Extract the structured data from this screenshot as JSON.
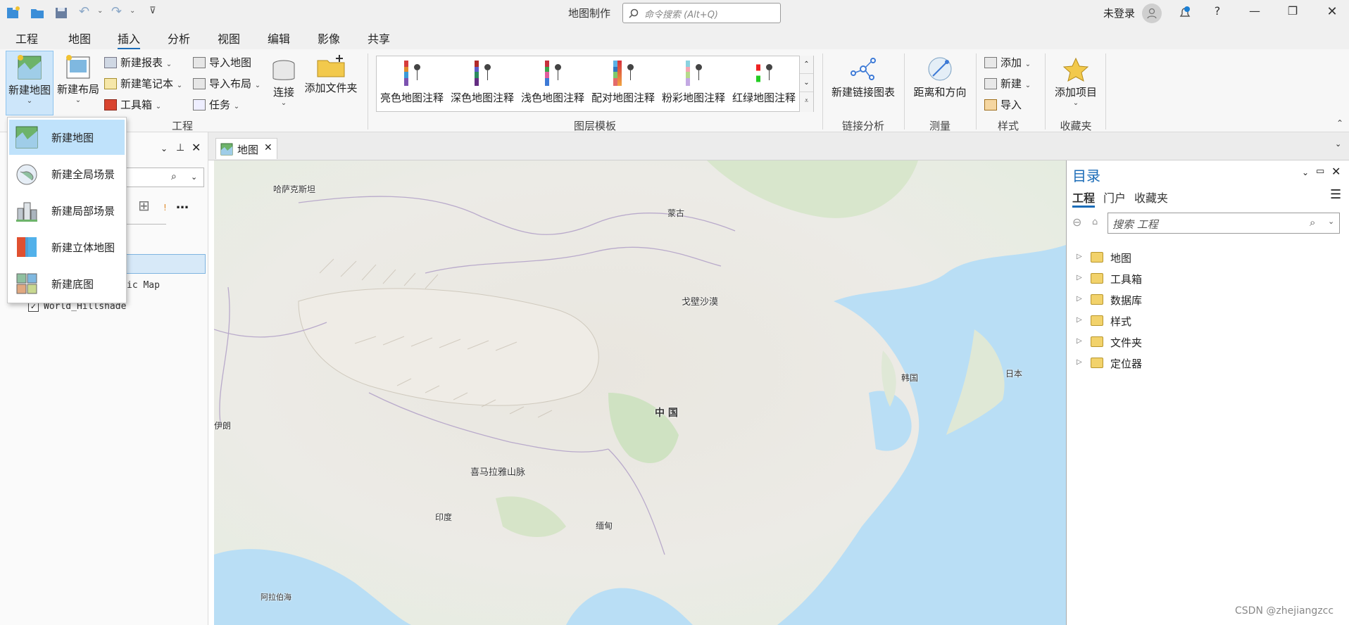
{
  "app": {
    "title": "地图制作",
    "command_search_placeholder": "命令搜索 (Alt+Q)",
    "login": "未登录"
  },
  "menu_tabs": [
    "工程",
    "地图",
    "插入",
    "分析",
    "视图",
    "编辑",
    "影像",
    "共享"
  ],
  "active_tab": "插入",
  "ribbon": {
    "project_group": {
      "label": "工程",
      "new_map": "新建地图",
      "new_layout": "新建布局",
      "new_report": "新建报表",
      "new_notebook": "新建笔记本",
      "toolbox": "工具箱",
      "import_map": "导入地图",
      "import_layout": "导入布局",
      "tasks": "任务",
      "connect": "连接",
      "add_folder": "添加文件夹"
    },
    "layer_templates": {
      "label": "图层模板",
      "items": [
        "亮色地图注释",
        "深色地图注释",
        "浅色地图注释",
        "配对地图注释",
        "粉彩地图注释",
        "红绿地图注释"
      ]
    },
    "link_analysis": {
      "label": "链接分析",
      "new_link_chart": "新建链接图表"
    },
    "measure": {
      "label": "测量",
      "distance_direction": "距离和方向"
    },
    "styles": {
      "label": "样式",
      "add": "添加",
      "new": "新建",
      "import": "导入"
    },
    "favorites": {
      "label": "收藏夹",
      "add_item": "添加项目"
    }
  },
  "new_map_dropdown": [
    "新建地图",
    "新建全局场景",
    "新建局部场景",
    "新建立体地图",
    "新建底图"
  ],
  "contents_pane": {
    "layers": [
      "ic Map",
      "World_Hillshade"
    ]
  },
  "map_view": {
    "tab_label": "地图",
    "labels": [
      "哈萨克斯坦",
      "蒙古",
      "戈壁沙漠",
      "韩国",
      "日本",
      "中 国",
      "伊朗",
      "喜马拉雅山脉",
      "印度",
      "缅甸",
      "阿拉伯海"
    ]
  },
  "catalog": {
    "title": "目录",
    "tabs": [
      "工程",
      "门户",
      "收藏夹"
    ],
    "search_placeholder": "搜索 工程",
    "items": [
      "地图",
      "工具箱",
      "数据库",
      "样式",
      "文件夹",
      "定位器"
    ]
  },
  "watermark": "CSDN @zhejiangzcc"
}
